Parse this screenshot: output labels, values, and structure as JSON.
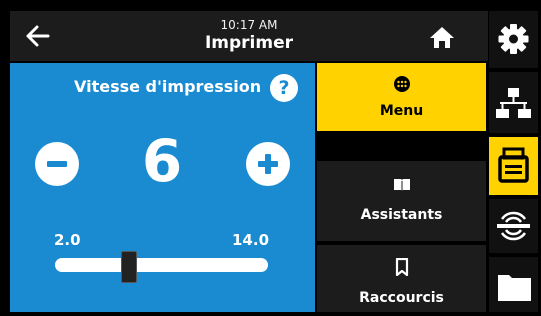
{
  "header": {
    "time": "10:17 AM",
    "title": "Imprimer"
  },
  "setting": {
    "title": "Vitesse d'impression",
    "help_glyph": "?",
    "value": "6",
    "min": "2.0",
    "max": "14.0",
    "slider_fraction": 0.33
  },
  "menu": {
    "items": [
      {
        "label": "Menu",
        "icon": "menu-dots-icon",
        "active": true
      },
      {
        "label": "Assistants",
        "icon": "book-icon",
        "active": false
      },
      {
        "label": "Raccourcis",
        "icon": "bookmark-icon",
        "active": false
      }
    ]
  },
  "sidebar": {
    "items": [
      {
        "icon": "gear-icon"
      },
      {
        "icon": "network-icon"
      },
      {
        "icon": "printer-icon",
        "active": true
      },
      {
        "icon": "rfid-icon"
      },
      {
        "icon": "folder-icon"
      }
    ]
  },
  "colors": {
    "panel": "#1a8bd1",
    "accent": "#ffd200",
    "header": "#1c1c1c"
  }
}
